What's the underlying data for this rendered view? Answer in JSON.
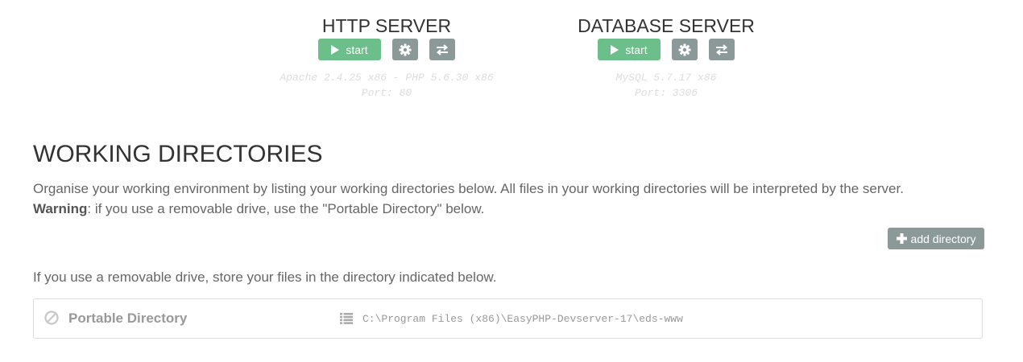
{
  "http_server": {
    "title": "HTTP SERVER",
    "start_label": "start",
    "info_line1": "Apache 2.4.25 x86 - PHP 5.6.30 x86",
    "info_line2": "Port: 80"
  },
  "database_server": {
    "title": "DATABASE SERVER",
    "start_label": "start",
    "info_line1": "MySQL 5.7.17 x86",
    "info_line2": "Port: 3306"
  },
  "working_directories": {
    "title": "WORKING DIRECTORIES",
    "description": "Organise your working environment by listing your working directories below. All files in your working directories will be interpreted by the server.",
    "warning_label": "Warning",
    "warning_text": ": if you use a removable drive, use the \"Portable Directory\" below.",
    "add_button_label": "add directory",
    "removable_note": "If you use a removable drive, store your files in the directory indicated below.",
    "portable": {
      "label": "Portable Directory",
      "path": "C:\\Program Files (x86)\\EasyPHP-Devserver-17\\eds-www"
    }
  },
  "icons": {
    "start": "play-icon",
    "settings": "gear-icon",
    "switch": "exchange-icon",
    "add": "plus-icon",
    "disabled": "ban-icon",
    "list": "list-icon"
  },
  "colors": {
    "start_button": "#6cbf8b",
    "icon_button": "#8b9a98",
    "info_text": "#dddddd"
  }
}
